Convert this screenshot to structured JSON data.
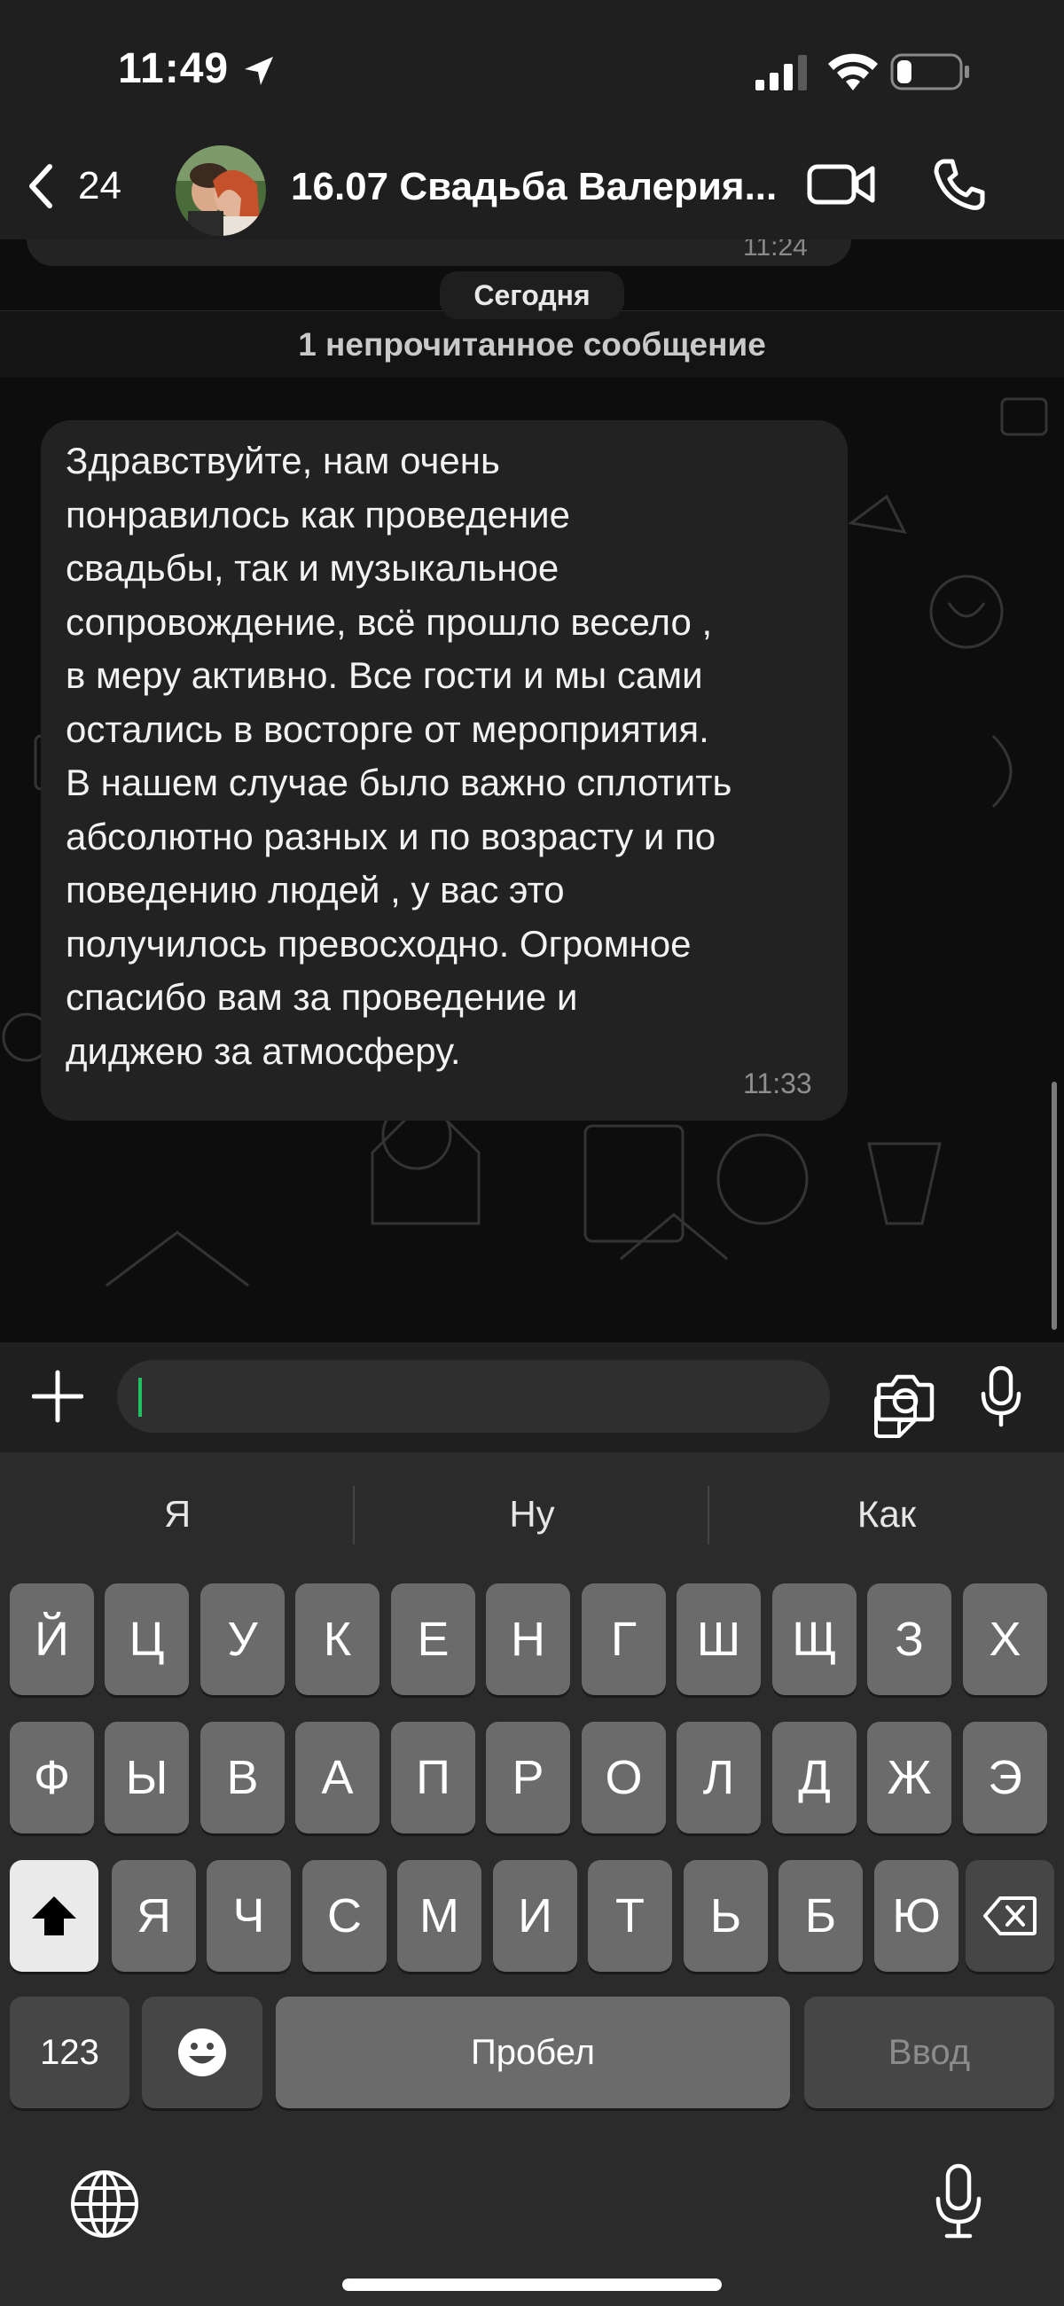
{
  "status_bar": {
    "time": "11:49",
    "icons": [
      "location-arrow-icon",
      "cellular-signal-icon",
      "wifi-icon",
      "battery-icon"
    ],
    "battery_level": 0.15
  },
  "header": {
    "back_count": "24",
    "title": "16.07 Свадьба Валерия...",
    "icons": [
      "chevron-left-icon",
      "video-call-icon",
      "phone-icon"
    ]
  },
  "chat": {
    "previous_message_time": "11:24",
    "date_chip": "Сегодня",
    "unread_banner": "1 непрочитанное сообщение",
    "message": {
      "text": "Здравствуйте, нам очень\nпонравилось как проведение\nсвадьбы, так и музыкальное\nсопровождение, всё прошло весело ,\nв меру активно. Все гости и мы сами\nостались в восторге от мероприятия.\nВ нашем случае было важно сплотить\nабсолютно разных и по возрасту и по\nповедению людей , у вас это\nполучилось превосходно. Огромное\nспасибо вам за проведение и\nдиджею за атмосферу.",
      "time": "11:33"
    }
  },
  "input_bar": {
    "value": "",
    "icons": [
      "plus-icon",
      "sticker-icon",
      "camera-icon",
      "microphone-icon"
    ]
  },
  "keyboard": {
    "suggestions": [
      "Я",
      "Ну",
      "Как"
    ],
    "row1": [
      "Й",
      "Ц",
      "У",
      "К",
      "Е",
      "Н",
      "Г",
      "Ш",
      "Щ",
      "З",
      "Х"
    ],
    "row2": [
      "Ф",
      "Ы",
      "В",
      "А",
      "П",
      "Р",
      "О",
      "Л",
      "Д",
      "Ж",
      "Э"
    ],
    "row3": [
      "Я",
      "Ч",
      "С",
      "М",
      "И",
      "Т",
      "Ь",
      "Б",
      "Ю"
    ],
    "numbers_label": "123",
    "space_label": "Пробел",
    "enter_label": "Ввод",
    "icons": [
      "shift-icon",
      "backspace-icon",
      "emoji-icon",
      "globe-icon",
      "dictation-icon"
    ]
  },
  "colors": {
    "accent_green": "#21c063",
    "bubble_bg": "#222222",
    "keyboard_bg": "#2b2b2b"
  }
}
